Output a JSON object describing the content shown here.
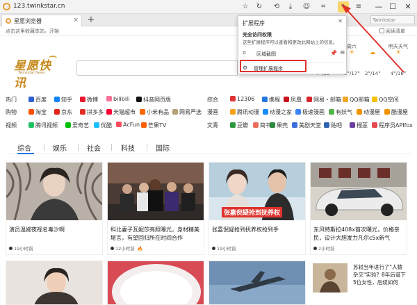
{
  "browser": {
    "url": "123.twinkstar.cn",
    "tab_title": "星愿浏览器",
    "tab_close": "×",
    "new_tab": "+",
    "right_box": "Twinkstar Browser",
    "tools": [
      "☆",
      "↻",
      "⟲",
      "⤓",
      "☺",
      "⌗",
      "✦",
      "≡"
    ],
    "window_buttons": [
      "—",
      "☐",
      "✕"
    ]
  },
  "bookmark_bar": {
    "hint": "点击这里收藏本站。开始",
    "reading_mode": "阅读清单"
  },
  "logo": {
    "text": "星愿快讯",
    "sub": "Twinkstar News"
  },
  "weather": {
    "days": [
      {
        "label": "",
        "icon": "☀",
        "temp": "7°/15°"
      },
      {
        "label": "周六",
        "icon": "☀",
        "temp": "8°/17°"
      },
      {
        "label": "",
        "icon": "☁",
        "temp": "2°/14°"
      },
      {
        "label": "明天天气",
        "icon": "☀",
        "temp": "4°/16°"
      }
    ]
  },
  "categories": [
    {
      "label": "热门",
      "links": [
        {
          "text": "百度",
          "color": "#2f5fd1"
        },
        {
          "text": "知乎",
          "color": "#0a84ff"
        },
        {
          "text": "微博",
          "color": "#e6162d"
        },
        {
          "text": "bilibili",
          "color": "#fb7299"
        },
        {
          "text": "抖音网页版",
          "color": "#111111"
        }
      ],
      "label2": "综合",
      "links2": [
        {
          "text": "12306",
          "color": "#d33"
        },
        {
          "text": "携程",
          "color": "#2577e3"
        },
        {
          "text": "凤凰",
          "color": "#c7151f"
        },
        {
          "text": "网易・邮箱",
          "color": "#d6262c"
        },
        {
          "text": "QQ邮箱",
          "color": "#f5a623"
        },
        {
          "text": "QQ空间",
          "color": "#f6c100"
        }
      ]
    },
    {
      "label": "购物",
      "links": [
        {
          "text": "淘宝",
          "color": "#ff5000"
        },
        {
          "text": "京东",
          "color": "#e1251b"
        },
        {
          "text": "拼多多",
          "color": "#e02e24"
        },
        {
          "text": "天猫超市",
          "color": "#ff0036"
        },
        {
          "text": "小米有品",
          "color": "#ff6700"
        },
        {
          "text": "网易严选",
          "color": "#b4a078"
        }
      ],
      "label2": "漫画",
      "links2": [
        {
          "text": "腾讯动漫",
          "color": "#f9a01b"
        },
        {
          "text": "动漫之家",
          "color": "#1a8cff"
        },
        {
          "text": "极速漫画",
          "color": "#3b82f6"
        },
        {
          "text": "有妖气",
          "color": "#53b44a"
        },
        {
          "text": "动漫屋",
          "color": "#f29400"
        },
        {
          "text": "酷漫屋",
          "color": "#f29400"
        }
      ]
    },
    {
      "label": "视频",
      "links": [
        {
          "text": "腾讯视频",
          "color": "#1dbf63"
        },
        {
          "text": "爱奇艺",
          "color": "#00be06"
        },
        {
          "text": "优酷",
          "color": "#1ebeff"
        },
        {
          "text": "AcFun",
          "color": "#fd4c5d"
        },
        {
          "text": "芒果TV",
          "color": "#ff5f00"
        }
      ],
      "label2": "文青",
      "links2": [
        {
          "text": "豆瓣",
          "color": "#2e963d"
        },
        {
          "text": "简书",
          "color": "#ea6f5a"
        },
        {
          "text": "果壳",
          "color": "#2b8a3e"
        },
        {
          "text": "美剧天堂",
          "color": "#3b6ed8"
        },
        {
          "text": "贴吧",
          "color": "#2d64b3"
        },
        {
          "text": "榴莲",
          "color": "#6b3fa0"
        },
        {
          "text": "程序员APIfox",
          "color": "#e5484d"
        }
      ]
    }
  ],
  "news_tabs": [
    "综合",
    "娱乐",
    "社会",
    "科技",
    "国际"
  ],
  "cards": [
    {
      "title": "演员温婉夜视名毒沙啊",
      "time": "19小时前",
      "hot": false
    },
    {
      "title": "科比妻子瓦妮莎亮照曝光，身材精美堪言，有望回归所在时间合作",
      "time": "12小时前",
      "hot": true
    },
    {
      "title": "张嘉倪疑抢到抚养权抢到手",
      "time": "19小时前",
      "hot": false,
      "overlay": "张嘉倪疑抢到抚养权"
    },
    {
      "title": "东风特斯拉408x首次曝光，价格亲民，设计大胆发力凡尔c5x新气",
      "time": "2小时前",
      "hot": false
    }
  ],
  "side_card": {
    "title": "苏轼当年进行了\"人猿杂交\"实验？8年后诞下5位女性，后续如何"
  },
  "popup": {
    "title": "扩展程序",
    "close": "✕",
    "heading": "完全访问权限",
    "desc": "这些扩展程序可以查看和更改此网站上的信息。",
    "item_label": "区域截图",
    "item_icon": "⌗",
    "pin_icon": "📌",
    "more_icon": "≡",
    "manage_label": "管理扩展程序",
    "manage_icon": "⚙"
  },
  "colors": {
    "accent": "#1a73e8",
    "highlight": "#e0322b",
    "logo": "#c78a1d"
  }
}
